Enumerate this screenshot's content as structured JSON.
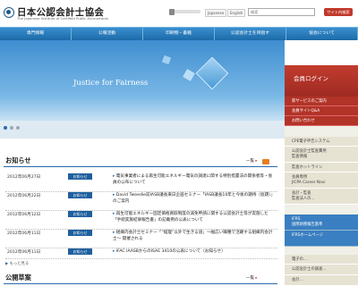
{
  "header": {
    "org_name": "日本公認会計士協会",
    "org_subtitle": "The Japanese Institute of Certified Public Accountants",
    "lang_ja": "Japanese",
    "lang_en": "English",
    "search_placeholder": "検索",
    "search_button": "サイト内検索"
  },
  "nav": {
    "items": [
      "専門情報",
      "公報活動",
      "印刷物・書籍",
      "公認会計士を目指す",
      "協会について"
    ]
  },
  "hero": {
    "tagline": "Justice for Fairness"
  },
  "side": {
    "login_title": "会員ログイン",
    "items": [
      "新サービスのご案内",
      "会員サイトQ&A",
      "お問い合わせ",
      "CPE電子申告システム",
      "公認会計士監査費用\n監査情報",
      "監査ホットライン",
      "会員専用\nJICPA Career Navi",
      "会計・監査\n監査法人の...",
      "IFRS\n国際財務報告基準",
      "IFRSホームページ",
      "電子の...",
      "公認会計士の調査...",
      "会計..."
    ]
  },
  "news": {
    "title": "お知らせ",
    "list_label": "一覧",
    "rows": [
      {
        "date": "2012年06月27日",
        "badge": "お知らせ",
        "text": "電気事業者による再生可能エネルギー電気の調達に関する特別措置法の関係者等・会員の公布について"
      },
      {
        "date": "2012年06月22日",
        "badge": "お知らせ",
        "text": "David Tweedie前IASB議長来日企画セミナー「IASB議長10年と今後の期待（仮題）」のご案内"
      },
      {
        "date": "2012年06月12日",
        "badge": "お知らせ",
        "text": "再生可能エネルギー固定価格買取制度の減免申請に関する公認会計士等が実施した「手続実施結果報告書」の記載例の公表について"
      },
      {
        "date": "2012年06月11日",
        "badge": "お知らせ",
        "text": "組織内会計士セミナー「“経理”以外で生きる道」〜幅広い職種で活躍する組織内会計士〜 開催される"
      },
      {
        "date": "2012年06月11日",
        "badge": "お知らせ",
        "text": "IFAC IAASBからのISAE 3410の公表について（お知らせ）"
      }
    ],
    "older_label": "もっと見る"
  },
  "public": {
    "title": "公開草案"
  },
  "colors": {
    "nav_blue": "#1c6aa8",
    "login_red": "#c23b2e",
    "badge_blue": "#1e5f9e"
  }
}
